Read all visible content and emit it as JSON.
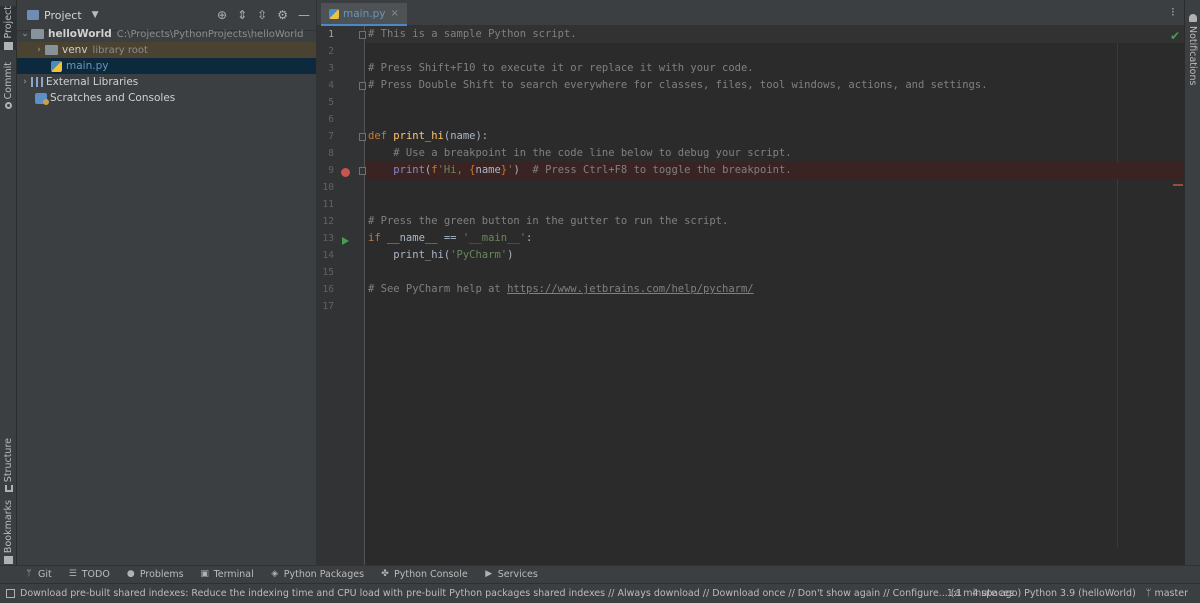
{
  "left_strip": {
    "project_tab": "Project",
    "commit_tab": "Commit",
    "structure_tab": "Structure",
    "bookmarks_tab": "Bookmarks"
  },
  "project_panel": {
    "title": "Project",
    "tree": [
      {
        "name": "helloWorld",
        "path": "C:\\Projects\\PythonProjects\\helloWorld"
      },
      {
        "name": "venv",
        "path": "library root"
      },
      {
        "name": "main.py"
      },
      {
        "name": "External Libraries"
      },
      {
        "name": "Scratches and Consoles"
      }
    ]
  },
  "editor": {
    "tab": {
      "name": "main.py",
      "close": "×"
    },
    "line_numbers": [
      "1",
      "2",
      "3",
      "4",
      "5",
      "6",
      "7",
      "8",
      "9",
      "10",
      "11",
      "12",
      "13",
      "14",
      "15",
      "16",
      "17"
    ],
    "code": {
      "l1": "# This is a sample Python script.",
      "l3": "# Press Shift+F10 to execute it or replace it with your code.",
      "l4": "# Press Double Shift to search everywhere for classes, files, tool windows, actions, and settings.",
      "l7_kw": "def ",
      "l7_fn": "print_hi",
      "l7_rest": "(name):",
      "l8": "    # Use a breakpoint in the code line below to debug your script.",
      "l9_indent": "    ",
      "l9_bi": "print",
      "l9_open": "(",
      "l9_f": "f",
      "l9_str1": "'Hi, ",
      "l9_brace_o": "{",
      "l9_name": "name",
      "l9_brace_c": "}",
      "l9_str2": "'",
      "l9_close": ")  ",
      "l9_com": "# Press Ctrl+F8 to toggle the breakpoint.",
      "l12": "# Press the green button in the gutter to run the script.",
      "l13_kw": "if ",
      "l13_txt": "__name__ == ",
      "l13_str": "'__main__'",
      "l13_colon": ":",
      "l14_txt": "    print_hi(",
      "l14_str": "'PyCharm'",
      "l14_close": ")",
      "l16_com": "# See PyCharm help at ",
      "l16_url": "https://www.jetbrains.com/help/pycharm/"
    }
  },
  "right_strip": {
    "notifications": "Notifications"
  },
  "bottom_tools": [
    "Git",
    "TODO",
    "Problems",
    "Terminal",
    "Python Packages",
    "Python Console",
    "Services"
  ],
  "status": {
    "message": "Download pre-built shared indexes: Reduce the indexing time and CPU load with pre-built Python packages shared indexes // Always download // Download once // Don't show again // Configure... (a minute ago)",
    "position": "1:1",
    "indent": "4 spaces",
    "interpreter": "Python 3.9 (helloWorld)",
    "branch": "master"
  }
}
